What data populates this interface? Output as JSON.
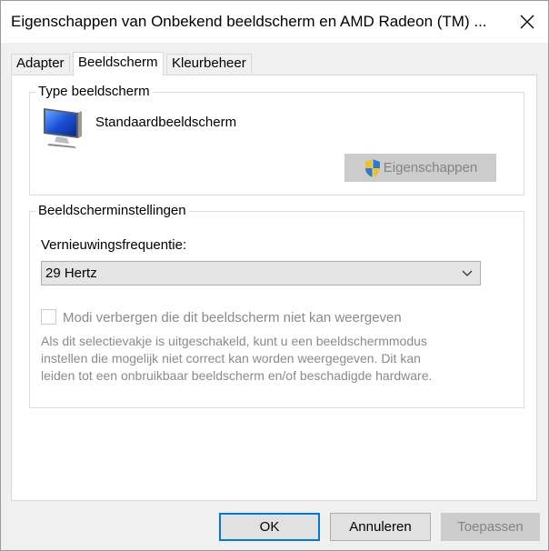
{
  "window": {
    "title": "Eigenschappen van Onbekend beeldscherm en AMD Radeon (TM) ...",
    "close_icon": "close-icon"
  },
  "tabs": [
    {
      "label": "Adapter",
      "active": false
    },
    {
      "label": "Beeldscherm",
      "active": true
    },
    {
      "label": "Kleurbeheer",
      "active": false
    }
  ],
  "monitor_type": {
    "group_label": "Type beeldscherm",
    "icon": "monitor-icon",
    "name": "Standaardbeeldscherm",
    "properties_button": "Eigenschappen",
    "properties_icon": "uac-shield-icon"
  },
  "monitor_settings": {
    "group_label": "Beeldscherminstellingen",
    "refresh_label": "Vernieuwingsfrequentie:",
    "refresh_value": "29 Hertz",
    "hide_modes_label": "Modi verbergen die dit beeldscherm niet kan weergeven",
    "hide_modes_checked": false,
    "description": "Als dit selectievakje is uitgeschakeld, kunt u een beeldschermmodus\ninstellen die mogelijk niet correct kan worden weergegeven. Dit kan\nleiden tot een onbruikbaar beeldscherm en/of beschadigde hardware."
  },
  "footer": {
    "ok": "OK",
    "cancel": "Annuleren",
    "apply": "Toepassen"
  },
  "colors": {
    "accent": "#0078d7",
    "disabled_text": "#838383"
  }
}
